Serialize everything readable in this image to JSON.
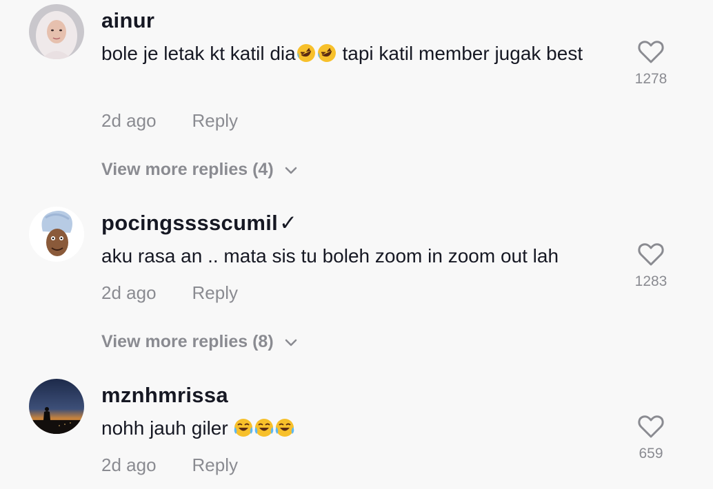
{
  "comments": [
    {
      "username": "ainur",
      "text": "bole je letak kt katil dia",
      "text_after": " tapi katil member jugak best",
      "emoji": "rolling-on-floor-laughing-icon",
      "time": "2d ago",
      "reply_label": "Reply",
      "likes": "1278",
      "view_more": "View more replies (4)"
    },
    {
      "username": "pocingsssscumil",
      "verified_mark": "✓",
      "text": "aku rasa an .. mata sis tu boleh zoom in zoom out lah",
      "time": "2d ago",
      "reply_label": "Reply",
      "likes": "1283",
      "view_more": "View more replies (8)"
    },
    {
      "username": "mznhmrissa",
      "text": "nohh jauh giler ",
      "emoji": "face-with-tears-of-joy-icon",
      "time": "2d ago",
      "reply_label": "Reply",
      "likes": "659"
    }
  ],
  "colors": {
    "background": "#f8f8f8",
    "primary_text": "#161823",
    "secondary_text": "#8a8b91"
  }
}
